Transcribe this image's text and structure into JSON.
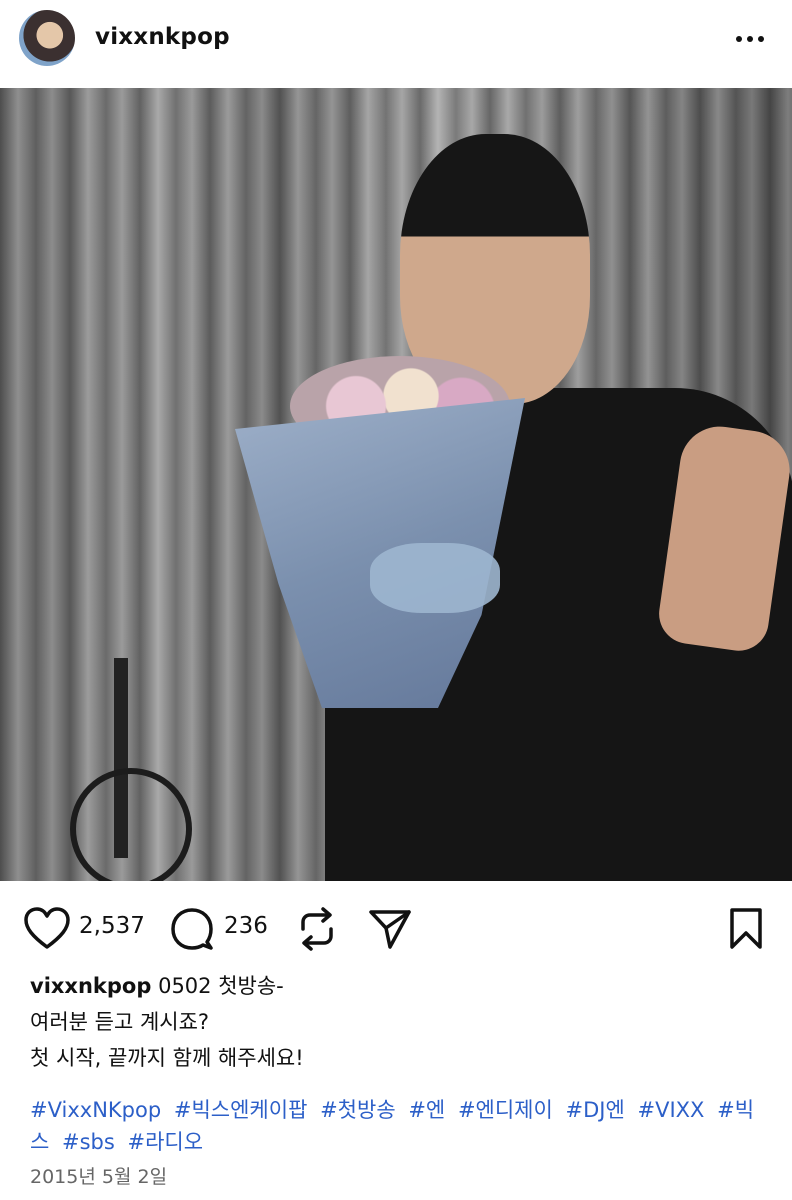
{
  "post": {
    "username": "vixxnkpop",
    "likes": "2,537",
    "comments": "236",
    "caption": {
      "first_line": "0502 첫방송-",
      "line2": "여러분 듣고 계시죠?",
      "line3": "첫 시작, 끝까지 함께 해주세요!"
    },
    "hashtags": [
      "#VixxNKpop",
      "#빅스엔케이팝",
      "#첫방송",
      "#엔",
      "#엔디제이",
      "#DJ엔",
      "#VIXX",
      "#빅스",
      "#sbs",
      "#라디오"
    ],
    "date": "2015년 5월 2일"
  },
  "icons": {
    "more": "more-options-icon",
    "like": "heart-icon",
    "comment": "comment-bubble-icon",
    "repost": "repost-icon",
    "share": "send-icon",
    "save": "bookmark-icon"
  },
  "colors": {
    "hashtag": "#2c5fc8",
    "date": "#666666"
  }
}
